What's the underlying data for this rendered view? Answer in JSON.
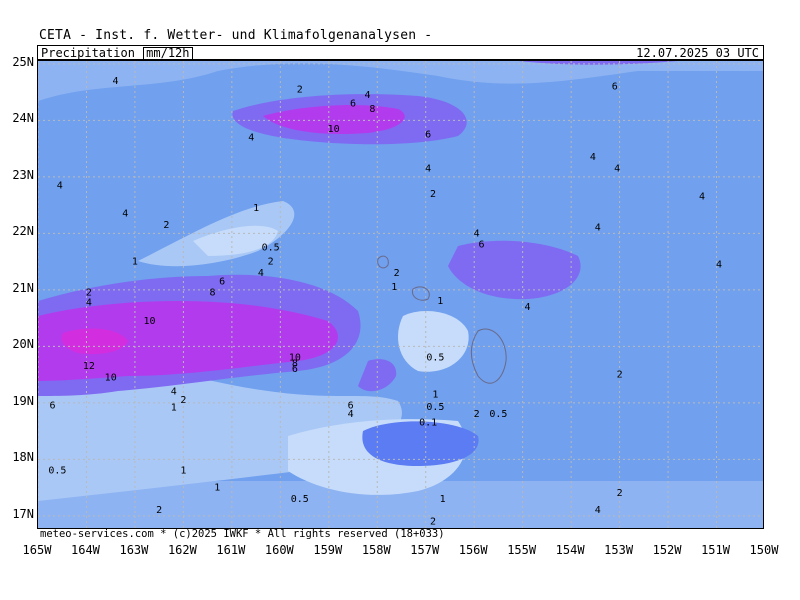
{
  "title": "CETA - Inst. f. Wetter- und Klimafolgenanalysen -",
  "header": {
    "variable": "Precipitation",
    "unit": "mm/12h",
    "datetime": "12.07.2025 03 UTC"
  },
  "footer": "meteo-services.com * (c)2025 IWKF * All rights reserved (18+033)",
  "axes": {
    "lat_labels": [
      "25N",
      "24N",
      "23N",
      "22N",
      "21N",
      "20N",
      "19N",
      "18N",
      "17N"
    ],
    "lon_labels": [
      "165W",
      "164W",
      "163W",
      "162W",
      "161W",
      "160W",
      "159W",
      "158W",
      "157W",
      "156W",
      "155W",
      "154W",
      "153W",
      "152W",
      "151W",
      "150W"
    ]
  },
  "colors": {
    "level_0_5": "#c6dcfa",
    "level_1": "#a9c8f6",
    "level_2": "#8db3f2",
    "level_4": "#70a0ee",
    "level_6": "#5b7cf2",
    "level_8": "#7f6af2",
    "level_10": "#b23ced",
    "level_12": "#d22ee0"
  },
  "contour_labels": [
    {
      "text": "4",
      "lon": -163.4,
      "lat": 24.7
    },
    {
      "text": "2",
      "lon": -159.6,
      "lat": 24.55
    },
    {
      "text": "4",
      "lon": -158.2,
      "lat": 24.45
    },
    {
      "text": "6",
      "lon": -158.5,
      "lat": 24.3
    },
    {
      "text": "8",
      "lon": -158.1,
      "lat": 24.2
    },
    {
      "text": "10",
      "lon": -158.9,
      "lat": 23.85
    },
    {
      "text": "6",
      "lon": -156.95,
      "lat": 23.75
    },
    {
      "text": "4",
      "lon": -160.6,
      "lat": 23.7
    },
    {
      "text": "4",
      "lon": -156.95,
      "lat": 23.15
    },
    {
      "text": "2",
      "lon": -156.85,
      "lat": 22.7
    },
    {
      "text": "4",
      "lon": -164.55,
      "lat": 22.85
    },
    {
      "text": "4",
      "lon": -163.2,
      "lat": 22.35
    },
    {
      "text": "2",
      "lon": -162.35,
      "lat": 22.15
    },
    {
      "text": "1",
      "lon": -160.5,
      "lat": 22.45
    },
    {
      "text": "0.5",
      "lon": -160.2,
      "lat": 21.75
    },
    {
      "text": "2",
      "lon": -160.2,
      "lat": 21.5
    },
    {
      "text": "4",
      "lon": -160.4,
      "lat": 21.3
    },
    {
      "text": "1",
      "lon": -163.0,
      "lat": 21.5
    },
    {
      "text": "6",
      "lon": -161.2,
      "lat": 21.15
    },
    {
      "text": "8",
      "lon": -161.4,
      "lat": 20.95
    },
    {
      "text": "2",
      "lon": -163.95,
      "lat": 20.95
    },
    {
      "text": "4",
      "lon": -163.95,
      "lat": 20.78
    },
    {
      "text": "10",
      "lon": -162.7,
      "lat": 20.45
    },
    {
      "text": "12",
      "lon": -163.95,
      "lat": 19.65
    },
    {
      "text": "10",
      "lon": -163.5,
      "lat": 19.45
    },
    {
      "text": "10",
      "lon": -159.7,
      "lat": 19.8
    },
    {
      "text": "8",
      "lon": -159.7,
      "lat": 19.7
    },
    {
      "text": "6",
      "lon": -159.7,
      "lat": 19.6
    },
    {
      "text": "6",
      "lon": -164.7,
      "lat": 18.95
    },
    {
      "text": "4",
      "lon": -162.2,
      "lat": 19.2
    },
    {
      "text": "2",
      "lon": -162.0,
      "lat": 19.05
    },
    {
      "text": "1",
      "lon": -162.2,
      "lat": 18.92
    },
    {
      "text": "2",
      "lon": -157.6,
      "lat": 21.3
    },
    {
      "text": "1",
      "lon": -157.65,
      "lat": 21.05
    },
    {
      "text": "1",
      "lon": -156.7,
      "lat": 20.8
    },
    {
      "text": "0.5",
      "lon": -156.8,
      "lat": 19.8
    },
    {
      "text": "1",
      "lon": -156.8,
      "lat": 19.15
    },
    {
      "text": "0.5",
      "lon": -156.8,
      "lat": 18.93
    },
    {
      "text": "0.1",
      "lon": -156.95,
      "lat": 18.65
    },
    {
      "text": "2",
      "lon": -155.95,
      "lat": 18.8
    },
    {
      "text": "0.5",
      "lon": -155.5,
      "lat": 18.8
    },
    {
      "text": "6",
      "lon": -158.55,
      "lat": 18.95
    },
    {
      "text": "4",
      "lon": -158.55,
      "lat": 18.8
    },
    {
      "text": "4",
      "lon": -155.95,
      "lat": 22.0
    },
    {
      "text": "6",
      "lon": -155.85,
      "lat": 21.8
    },
    {
      "text": "4",
      "lon": -154.9,
      "lat": 20.7
    },
    {
      "text": "6",
      "lon": -153.1,
      "lat": 24.6
    },
    {
      "text": "4",
      "lon": -153.55,
      "lat": 23.35
    },
    {
      "text": "4",
      "lon": -153.05,
      "lat": 23.15
    },
    {
      "text": "4",
      "lon": -151.3,
      "lat": 22.65
    },
    {
      "text": "4",
      "lon": -153.45,
      "lat": 22.1
    },
    {
      "text": "4",
      "lon": -150.95,
      "lat": 21.45
    },
    {
      "text": "2",
      "lon": -153.0,
      "lat": 19.5
    },
    {
      "text": "2",
      "lon": -153.0,
      "lat": 17.4
    },
    {
      "text": "4",
      "lon": -153.45,
      "lat": 17.1
    },
    {
      "text": "0.5",
      "lon": -164.6,
      "lat": 17.8
    },
    {
      "text": "1",
      "lon": -162.0,
      "lat": 17.8
    },
    {
      "text": "1",
      "lon": -161.3,
      "lat": 17.5
    },
    {
      "text": "0.5",
      "lon": -159.6,
      "lat": 17.3
    },
    {
      "text": "1",
      "lon": -156.65,
      "lat": 17.3
    },
    {
      "text": "2",
      "lon": -162.5,
      "lat": 17.1
    },
    {
      "text": "2",
      "lon": -156.85,
      "lat": 16.9
    }
  ]
}
